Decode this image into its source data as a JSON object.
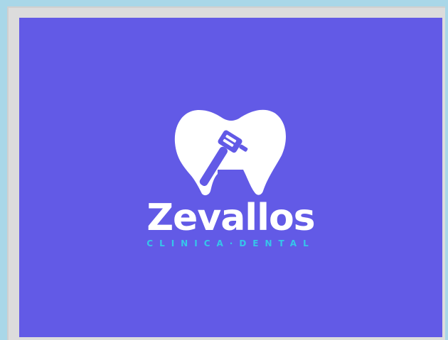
{
  "logo": {
    "name": "Zevallos",
    "tagline": "CLINICA·DENTAL",
    "icon": "tooth-with-dental-drill-icon"
  },
  "colors": {
    "background": "#625ae6",
    "logo_primary": "#ffffff",
    "logo_accent": "#36c6ea",
    "outer_background": "#a9d7e8",
    "frame": "#dcdcdc"
  }
}
